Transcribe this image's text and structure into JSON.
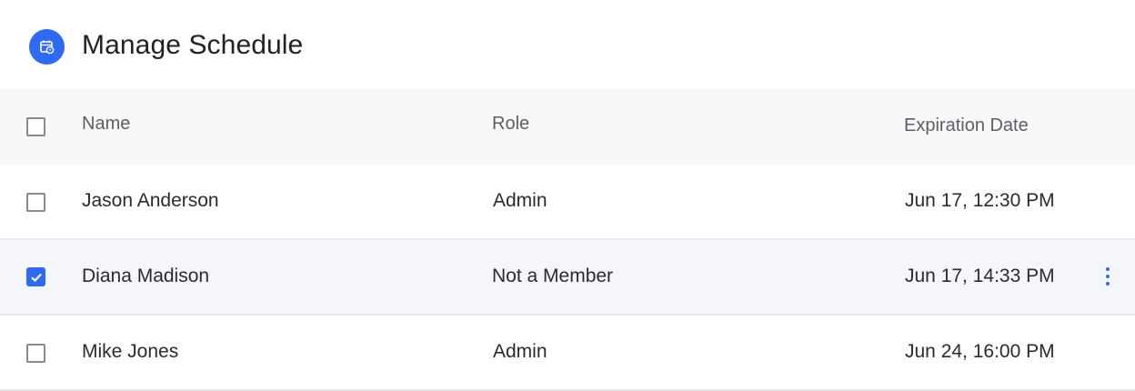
{
  "header": {
    "title": "Manage Schedule",
    "icon": "calendar-clock-icon",
    "accent_color": "#2f6bf2"
  },
  "table": {
    "columns": [
      "Name",
      "Role",
      "Expiration Date"
    ],
    "rows": [
      {
        "name": "Jason Anderson",
        "role": "Admin",
        "expiration": "Jun 17, 12:30 PM",
        "checked": false
      },
      {
        "name": "Diana Madison",
        "role": "Not a Member",
        "expiration": "Jun 17, 14:33 PM",
        "checked": true
      },
      {
        "name": "Mike Jones",
        "role": "Admin",
        "expiration": "Jun 24, 16:00 PM",
        "checked": false
      }
    ]
  }
}
